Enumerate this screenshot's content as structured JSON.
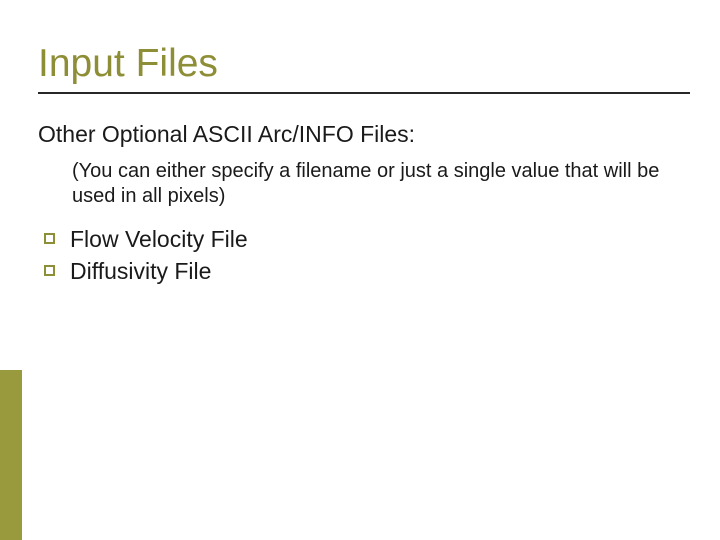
{
  "title": "Input Files",
  "subheading": "Other Optional ASCII Arc/INFO Files:",
  "note": "(You can either specify a filename or just a single value that will be used in all pixels)",
  "bullets": {
    "item0": "Flow Velocity File",
    "item1": "Diffusivity File"
  }
}
